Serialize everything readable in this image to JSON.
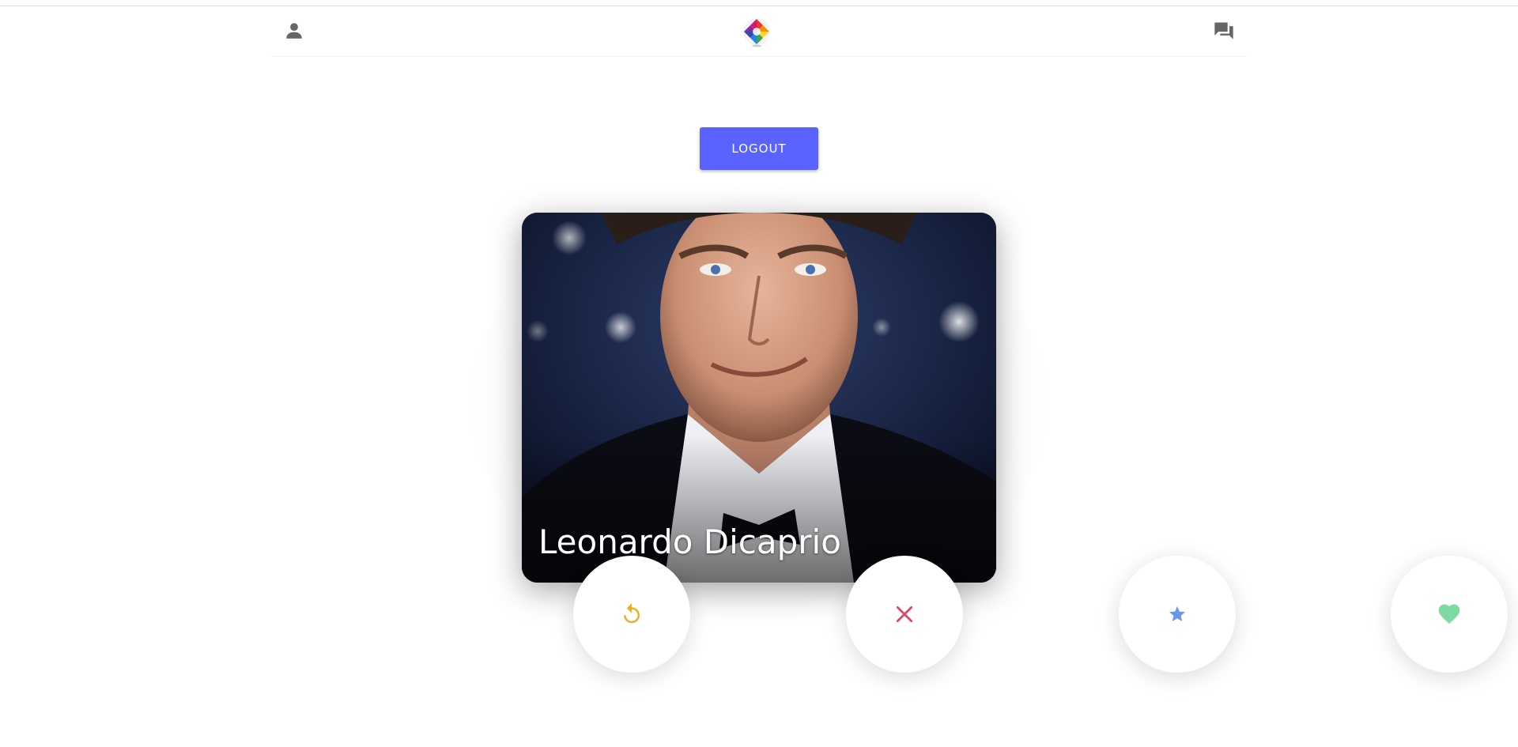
{
  "header": {
    "profile_icon": "person-icon",
    "logo_icon": "app-logo-icon",
    "chat_icon": "chat-bubbles-icon"
  },
  "logout": {
    "label": "LOGOUT",
    "color": "#5a63ff"
  },
  "card": {
    "name": "Leonardo Dicaprio"
  },
  "actions": [
    {
      "name": "rewind",
      "icon": "rewind-icon",
      "color": "#e6b02e"
    },
    {
      "name": "nope",
      "icon": "close-icon",
      "color": "#d94a68"
    },
    {
      "name": "super-like",
      "icon": "star-icon",
      "color": "#6f96e6"
    },
    {
      "name": "like",
      "icon": "heart-icon",
      "color": "#7fd9a2"
    }
  ]
}
